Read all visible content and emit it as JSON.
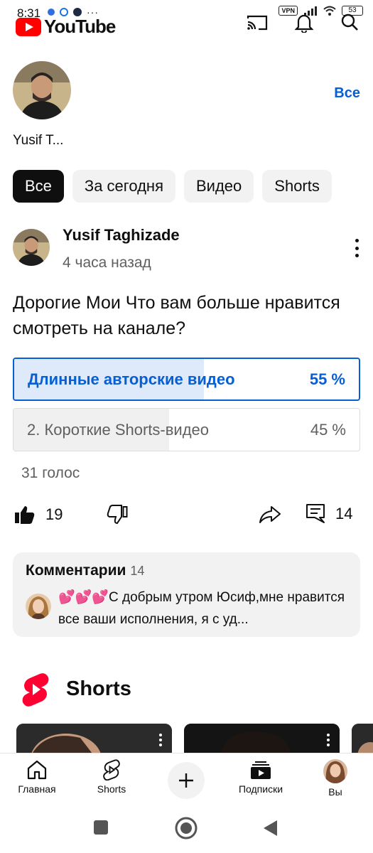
{
  "status_bar": {
    "time": "8:31",
    "vpn": "VPN",
    "battery": "53",
    "more": "···"
  },
  "header": {
    "logo_text": "YouTube"
  },
  "channel_strip": {
    "name": "Yusif T...",
    "all_link": "Все"
  },
  "chips": [
    {
      "label": "Все",
      "active": true
    },
    {
      "label": "За сегодня",
      "active": false
    },
    {
      "label": "Видео",
      "active": false
    },
    {
      "label": "Shorts",
      "active": false
    }
  ],
  "post": {
    "author": "Yusif Taghizade",
    "time": "4 часа назад",
    "text": "Дорогие Мои Что вам больше нравится смотреть на канале?",
    "poll": {
      "options": [
        {
          "label": "Длинные авторские видео",
          "percent_text": "55 %",
          "percent": 55,
          "selected": true
        },
        {
          "label": "2. Короткие Shorts-видео",
          "percent_text": "45 %",
          "percent": 45,
          "selected": false
        }
      ],
      "votes": "31 голос"
    },
    "actions": {
      "likes": "19",
      "comments": "14"
    }
  },
  "comments": {
    "title": "Комментарии",
    "count": "14",
    "preview_hearts": "💕💕💕",
    "preview_text": "С добрым утром Юсиф,мне нравится все ваши исполнения, я с уд..."
  },
  "shorts": {
    "title": "Shorts"
  },
  "bottom_nav": [
    {
      "label": "Главная",
      "icon": "home-icon"
    },
    {
      "label": "Shorts",
      "icon": "shorts-icon"
    },
    {
      "label": "",
      "icon": "plus-icon"
    },
    {
      "label": "Подписки",
      "icon": "subscriptions-icon"
    },
    {
      "label": "Вы",
      "icon": "avatar"
    }
  ],
  "colors": {
    "accent": "#065fd4",
    "brand_red": "#ff0000",
    "chip_bg": "#f2f2f2",
    "text": "#0f0f0f",
    "secondary_text": "#606060"
  }
}
